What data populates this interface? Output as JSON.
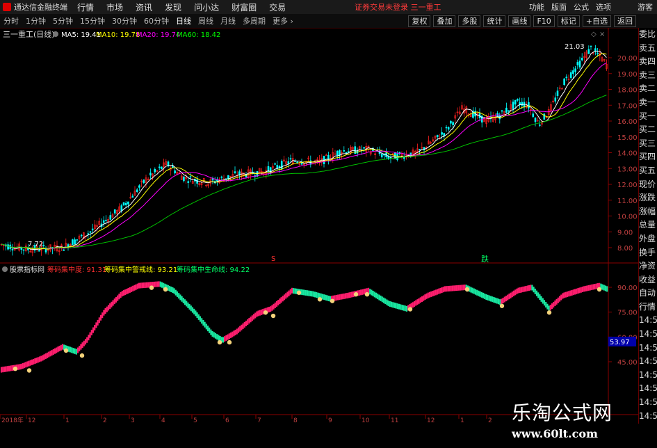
{
  "menubar": {
    "app_title": "通达信金融终端",
    "items": [
      "行情",
      "市场",
      "资讯",
      "发现",
      "问小达",
      "财富圈",
      "交易"
    ],
    "warning": "证券交易未登录  三一重工",
    "right_items": [
      "功能",
      "版面",
      "公式",
      "选项"
    ],
    "guest": "游客"
  },
  "toolbar": {
    "periods": [
      "分时",
      "1分钟",
      "5分钟",
      "15分钟",
      "30分钟",
      "60分钟",
      "日线",
      "周线",
      "月线",
      "多周期",
      "更多 ›"
    ],
    "active_period": "日线",
    "right_buttons": [
      "复权",
      "叠加",
      "多股",
      "统计",
      "画线",
      "F10",
      "标记",
      "+自选",
      "返回"
    ]
  },
  "main_chart": {
    "title": "三一重工(日线)",
    "ma": [
      {
        "label": "MA5: 19.41",
        "color": "#ffffff"
      },
      {
        "label": "MA10: 19.78",
        "color": "#ffff00"
      },
      {
        "label": "MA20: 19.74",
        "color": "#ff00ff"
      },
      {
        "label": "MA60: 18.42",
        "color": "#00ff00"
      }
    ],
    "y_ticks": [
      "20.00",
      "19.00",
      "18.00",
      "17.00",
      "16.00",
      "15.00",
      "14.00",
      "13.00",
      "12.00",
      "11.00",
      "10.00",
      "9.00",
      "8.00"
    ],
    "high_label": "21.03",
    "low_label": "7.72",
    "marker_s": "S",
    "marker_die": "跌"
  },
  "indicator": {
    "title": "股票指标网",
    "items": [
      {
        "label": "筹码集中度: 91.31",
        "color": "#ff3030"
      },
      {
        "label": "筹码集中警戒线: 93.21",
        "color": "#ffff00"
      },
      {
        "label": "筹码集中生命线: 94.22",
        "color": "#00ff66"
      }
    ],
    "y_ticks": [
      "90.00",
      "75.00",
      "60.00",
      "45.00"
    ],
    "current_value": "53.97"
  },
  "x_axis": {
    "labels": [
      "2018年",
      "12",
      "1",
      "2",
      "3",
      "4",
      "5",
      "6",
      "7",
      "8",
      "9",
      "10",
      "11",
      "12",
      "1",
      "2"
    ]
  },
  "side_panel": {
    "items": [
      "委比",
      "卖五",
      "卖四",
      "卖三",
      "卖二",
      "卖一",
      "买一",
      "买二",
      "买三",
      "买四",
      "买五",
      "现价",
      "涨跌",
      "涨幅",
      "总量",
      "外盘",
      "换手",
      "净资",
      "收益",
      "自动",
      "行情",
      "14:50",
      "14:50",
      "14:50",
      "14:50",
      "14:50",
      "14:50",
      "14:50",
      "14:50"
    ]
  },
  "watermark": {
    "name": "乐淘公式网",
    "url": "www.60lt.com"
  },
  "colors": {
    "up": "#ff2020",
    "down": "#00ffff",
    "axis": "#8b0000",
    "ma60": "#00c000"
  }
}
